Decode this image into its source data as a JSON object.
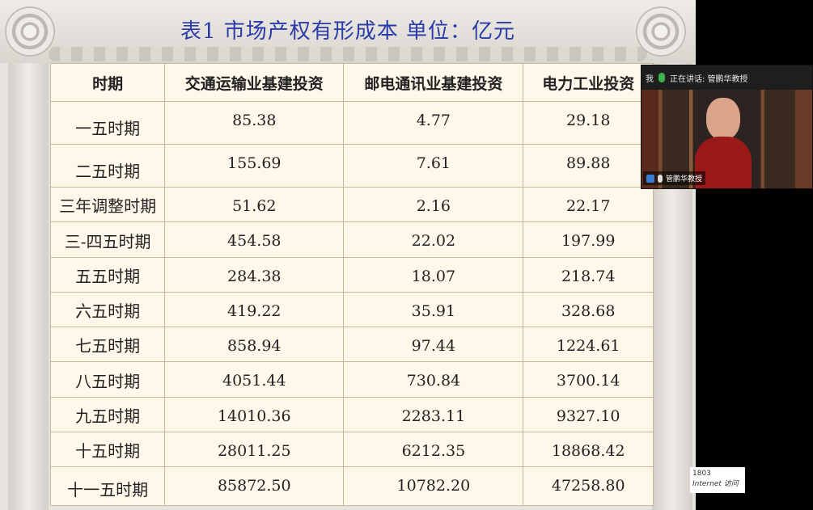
{
  "slide": {
    "title": "表1  市场产权有形成本  单位：亿元",
    "table": {
      "headers": [
        "时期",
        "交通运输业基建投资",
        "邮电通讯业基建投资",
        "电力工业投资"
      ],
      "rows": [
        {
          "period": "一五时期",
          "transport": "85.38",
          "telecom": "4.77",
          "power": "29.18"
        },
        {
          "period": "二五时期",
          "transport": "155.69",
          "telecom": "7.61",
          "power": "89.88"
        },
        {
          "period": "三年调整时期",
          "transport": "51.62",
          "telecom": "2.16",
          "power": "22.17"
        },
        {
          "period": "三-四五时期",
          "transport": "454.58",
          "telecom": "22.02",
          "power": "197.99"
        },
        {
          "period": "五五时期",
          "transport": "284.38",
          "telecom": "18.07",
          "power": "218.74"
        },
        {
          "period": "六五时期",
          "transport": "419.22",
          "telecom": "35.91",
          "power": "328.68"
        },
        {
          "period": "七五时期",
          "transport": "858.94",
          "telecom": "97.44",
          "power": "1224.61"
        },
        {
          "period": "八五时期",
          "transport": "4051.44",
          "telecom": "730.84",
          "power": "3700.14"
        },
        {
          "period": "九五时期",
          "transport": "14010.36",
          "telecom": "2283.11",
          "power": "9327.10"
        },
        {
          "period": "十五时期",
          "transport": "28011.25",
          "telecom": "6212.35",
          "power": "18868.42"
        },
        {
          "period": "十一五时期",
          "transport": "85872.50",
          "telecom": "10782.20",
          "power": "47258.80"
        }
      ]
    }
  },
  "video": {
    "self_label": "我",
    "speaking": "正在讲话: 管鹏华教授",
    "name": "管鹏华教授"
  },
  "badge": {
    "number": "1803",
    "text": "Internet 访问"
  },
  "colors": {
    "title": "#2a3aa8",
    "table_bg": "#fff7ea",
    "mic": "#3cb34a"
  }
}
